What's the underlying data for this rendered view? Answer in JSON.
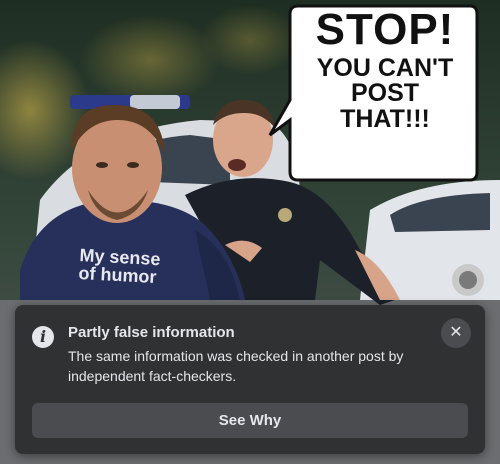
{
  "meme": {
    "speech_bubble": {
      "line1": "STOP!",
      "line2": "YOU CAN'T",
      "line3": "POST",
      "line4": "THAT!!!"
    },
    "shirt_text": {
      "line1": "My sense",
      "line2": "of humor"
    }
  },
  "notice": {
    "icon": "info-icon",
    "icon_glyph": "i",
    "title": "Partly false information",
    "description": "The same information was checked in another post by independent fact-checkers.",
    "close_glyph": "✕",
    "button_label": "See Why"
  },
  "colors": {
    "card_bg": "#303132",
    "button_bg": "#4a4c4f",
    "text": "#e4e6eb"
  }
}
